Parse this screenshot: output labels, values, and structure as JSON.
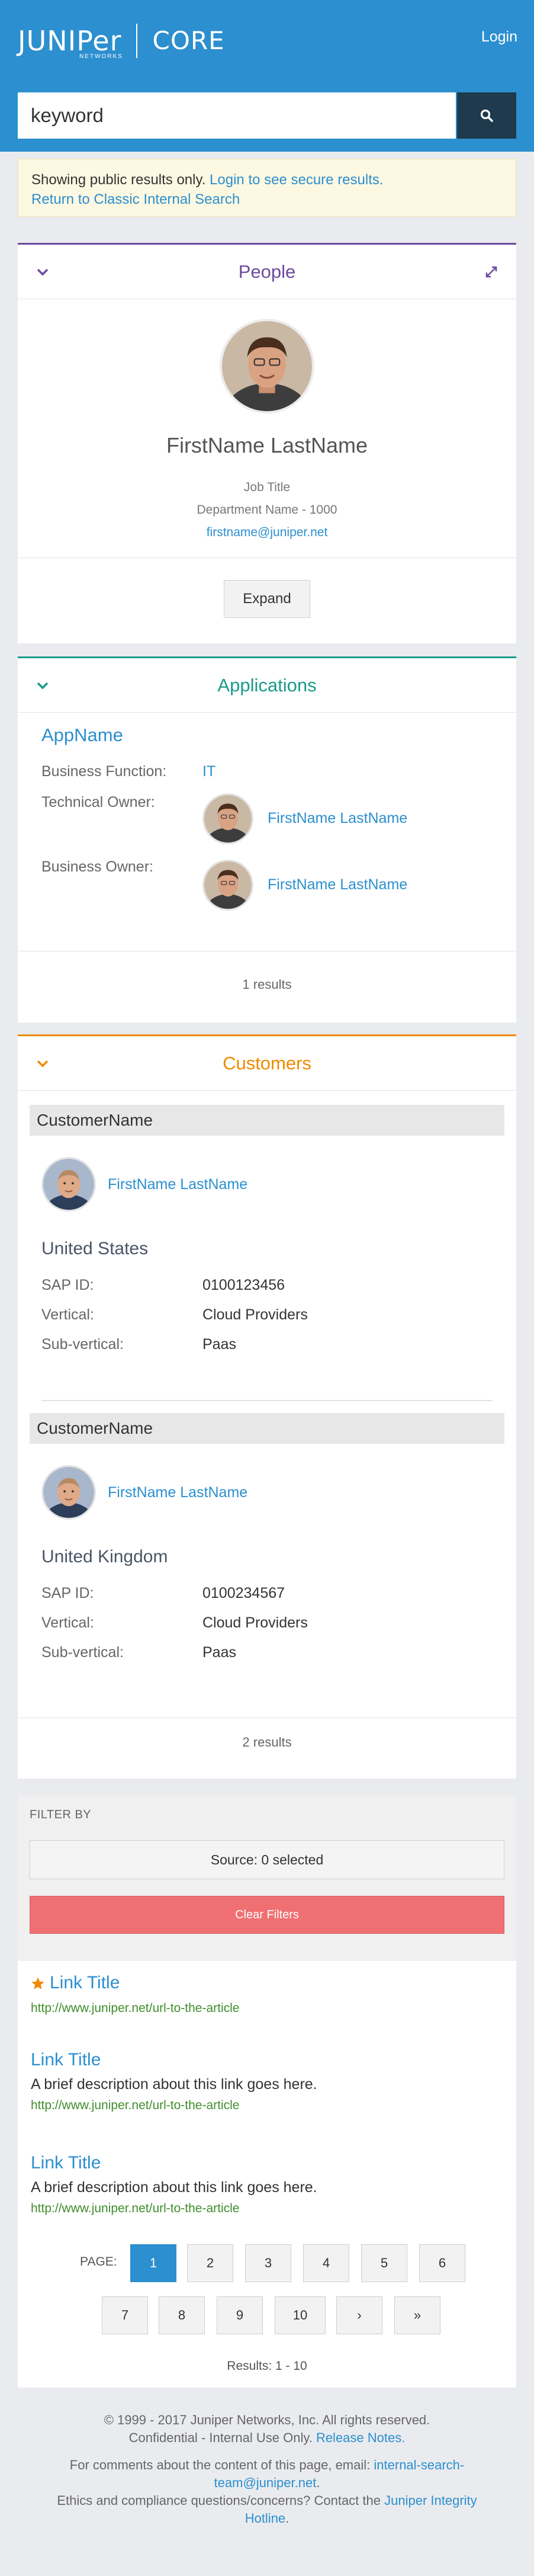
{
  "header": {
    "logo_text": "JUNIPer",
    "logo_sub": "NETWORKS",
    "app_name": "CORE",
    "login_label": "Login"
  },
  "search": {
    "value": "keyword",
    "button_icon": "search-icon"
  },
  "notice": {
    "text": "Showing public results only.",
    "login_link": "Login to see secure results.",
    "classic_link": "Return to Classic Internal Search"
  },
  "people": {
    "title": "People",
    "name": "FirstName LastName",
    "job_title": "Job Title",
    "department": "Department Name - 1000",
    "email": "firstname@juniper.net",
    "expand_label": "Expand"
  },
  "applications": {
    "title": "Applications",
    "app_name": "AppName",
    "business_function_label": "Business Function:",
    "business_function_value": "IT",
    "technical_owner_label": "Technical Owner:",
    "technical_owner_name": "FirstName LastName",
    "business_owner_label": "Business Owner:",
    "business_owner_name": "FirstName LastName",
    "results_count": "1 results"
  },
  "customers": {
    "title": "Customers",
    "items": [
      {
        "name": "CustomerName",
        "contact": "FirstName LastName",
        "country": "United States",
        "sap_label": "SAP ID:",
        "sap_value": "0100123456",
        "vertical_label": "Vertical:",
        "vertical_value": "Cloud Providers",
        "subvertical_label": "Sub-vertical:",
        "subvertical_value": "Paas"
      },
      {
        "name": "CustomerName",
        "contact": "FirstName LastName",
        "country": "United Kingdom",
        "sap_label": "SAP ID:",
        "sap_value": "0100234567",
        "vertical_label": "Vertical:",
        "vertical_value": "Cloud Providers",
        "subvertical_label": "Sub-vertical:",
        "subvertical_value": "Paas"
      }
    ],
    "results_count": "2 results"
  },
  "filters": {
    "heading": "FILTER BY",
    "source_label": "Source: 0 selected",
    "clear_label": "Clear Filters"
  },
  "results": [
    {
      "title": "Link Title",
      "description": "",
      "url": "http://www.juniper.net/url-to-the-article",
      "starred": true
    },
    {
      "title": "Link Title",
      "description": "A brief description about this link goes here.",
      "url": "http://www.juniper.net/url-to-the-article",
      "starred": false
    },
    {
      "title": "Link Title",
      "description": "A brief description about this link goes here.",
      "url": "http://www.juniper.net/url-to-the-article",
      "starred": false
    }
  ],
  "pagination": {
    "label": "PAGE:",
    "pages": [
      "1",
      "2",
      "3",
      "4",
      "5",
      "6",
      "7",
      "8",
      "9",
      "10",
      "›",
      "»"
    ],
    "current": "1",
    "results_range": "Results: 1 - 10"
  },
  "footer": {
    "copyright": "© 1999 - 2017 Juniper Networks, Inc. All rights reserved.",
    "confidential": "Confidential - Internal Use Only.",
    "release_notes": "Release Notes.",
    "comments_text": "For comments about the content of this page, email:",
    "comments_email_1": "internal-search-",
    "comments_email_2": "team@juniper.net",
    "period": ".",
    "ethics_text": "Ethics and compliance questions/concerns? Contact the",
    "hotline_1": "Juniper Integrity",
    "hotline_2": "Hotline",
    "colors": {
      "brand_blue": "#2c8fcf",
      "people_accent": "#6c4a9e",
      "apps_accent": "#1a9a8a",
      "customers_accent": "#f08a00",
      "danger": "#ef6f72"
    }
  }
}
